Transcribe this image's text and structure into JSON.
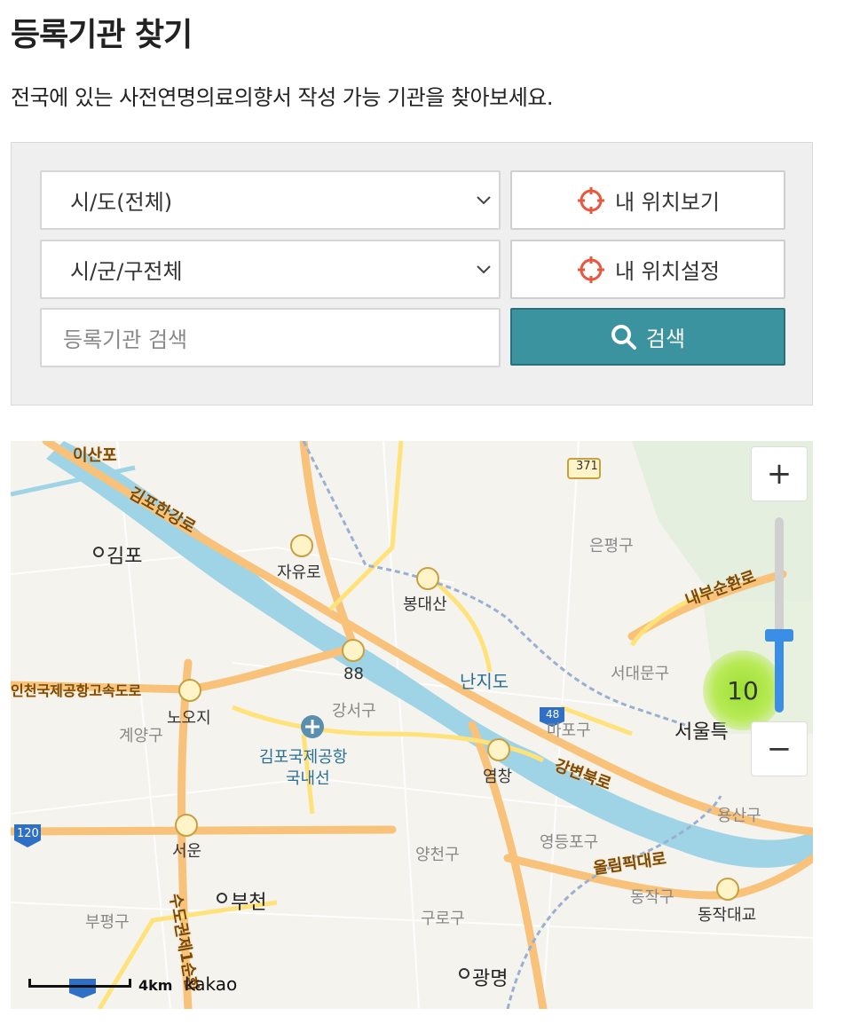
{
  "page": {
    "title": "등록기관 찾기",
    "description": "전국에 있는 사전연명의료의향서 작성 가능 기관을 찾아보세요."
  },
  "search": {
    "region_select": "시/도(전체)",
    "district_select": "시/군/구전체",
    "input_placeholder": "등록기관 검색",
    "my_location_view": "내 위치보기",
    "my_location_set": "내 위치설정",
    "search_button": "검색"
  },
  "map": {
    "labels": {
      "gimpo": "김포",
      "jayuro": "자유로",
      "bongdaesan": "봉대산",
      "eunpyeonggu": "은평구",
      "nanjido": "난지도",
      "seodaemungu": "서대문구",
      "mapogu": "마포구",
      "gangseogu": "강서구",
      "gimpo_airport": "김포국제공항",
      "domestic": "국내선",
      "nooji": "노오지",
      "gyeyanggu": "계양구",
      "yeomchang": "염창",
      "seoun": "서운",
      "yangcheongu": "양천구",
      "yeongdeungpogu": "영등포구",
      "yongsangu": "용산구",
      "dongjakgu": "동작구",
      "dongjakdaegyo": "동작대교",
      "bucheon": "부천",
      "bupyeonggu": "부평구",
      "gurogu": "구로구",
      "gwangmyeong": "광명",
      "seoul": "서울특",
      "jc_88": "88",
      "route_371": "371",
      "route_120": "120",
      "route_48": "48",
      "road_gimpo_hangang": "김포한강로",
      "road_airport_expressway": "인천국제공항고속도로",
      "road_naebu": "내부순환로",
      "road_gangbyeon": "강변북로",
      "road_olympic": "올림픽대로",
      "road_sudogwon": "수도권제1순환",
      "isanpo": "이산포"
    },
    "cluster_count": "10",
    "zoom_in": "+",
    "zoom_out": "−",
    "scale_label": "4km",
    "provider": "kakao",
    "zoom_level": 0.35
  },
  "colors": {
    "search_button": "#3b93a0",
    "river": "#9fd3e6",
    "highway": "#f8c27a",
    "cluster": "#9be033"
  }
}
